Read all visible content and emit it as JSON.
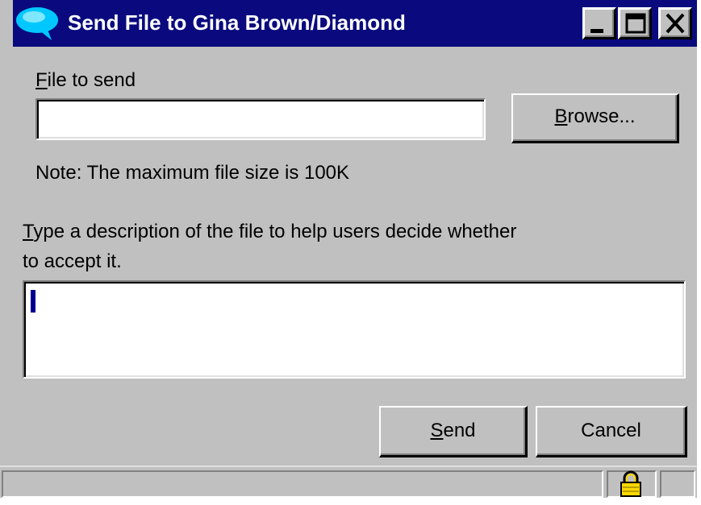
{
  "window": {
    "title": "Send File to Gina Brown/Diamond",
    "controls": [
      "minimize-icon",
      "maximize-icon",
      "close-icon"
    ]
  },
  "file": {
    "label_mnemonic": "F",
    "label_rest": "ile to send",
    "value": "",
    "browse_mnemonic": "B",
    "browse_rest": "rowse..."
  },
  "note": "Note: The maximum file size is 100K",
  "description": {
    "line1_mnemonic": "T",
    "line1_rest": "ype a description of the file to help users decide whether",
    "line2": "to accept it.",
    "value": ""
  },
  "actions": {
    "send_mnemonic": "S",
    "send_rest": "end",
    "cancel": "Cancel"
  },
  "status": {
    "text": "",
    "icon": "padlock-icon"
  },
  "colors": {
    "titlebar": "#0a0a7e",
    "face": "#c0c0c0",
    "caret": "#000090",
    "lock": "#ffd800"
  }
}
